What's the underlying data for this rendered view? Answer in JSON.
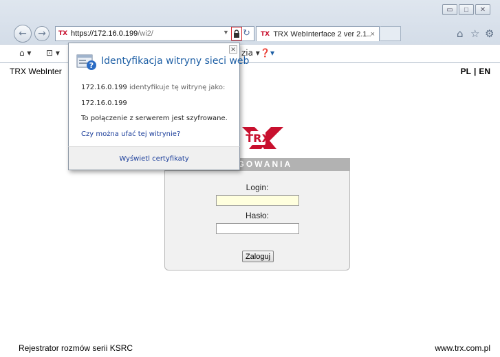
{
  "browser": {
    "address": {
      "url_main": "https://172.16.0.199",
      "url_path": "/wi2/"
    },
    "tab": {
      "title": "TRX WebInterface 2 ver 2.1....",
      "close": "×"
    },
    "command_bar": {
      "tail_label": "zia ▾"
    }
  },
  "page": {
    "top_text": "TRX WebInter",
    "lang": {
      "pl": "PL",
      "separator": "|",
      "en": "EN"
    },
    "logo_text": "TRX",
    "login": {
      "header": "LOGOWANIA",
      "login_label": "Login:",
      "password_label": "Hasło:",
      "login_value": "",
      "password_value": "",
      "submit_label": "Zaloguj"
    },
    "footer_left": "Rejestrator rozmów serii KSRC",
    "footer_right": "www.trx.com.pl"
  },
  "popup": {
    "title": "Identyfikacja witryny sieci web",
    "ip_line_ip": "172.16.0.199",
    "ip_line_rest": "identyfikuje tę witrynę jako:",
    "identity": "172.16.0.199",
    "encrypted": "To połączenie z serwerem jest szyfrowane.",
    "trust_link": "Czy można ufać tej witrynie?",
    "cert_link": "Wyświetl certyfikaty"
  },
  "colors": {
    "trx_red": "#c8102e",
    "link_blue": "#1a3d9a",
    "title_blue": "#1e5fa5"
  }
}
